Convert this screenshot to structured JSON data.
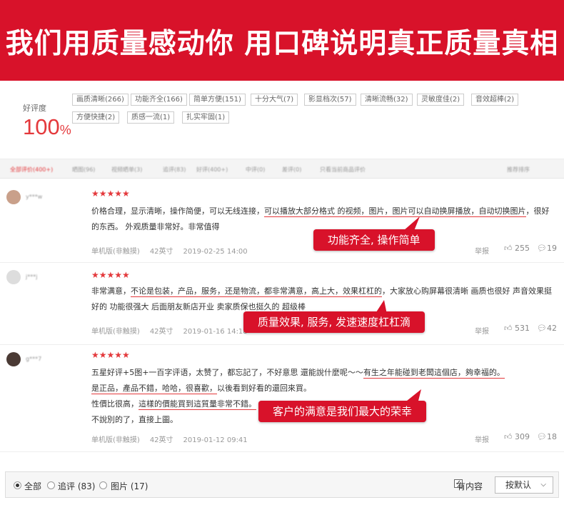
{
  "banner": {
    "title": "我们用质量感动你  用口碑说明真正质量真相"
  },
  "rating": {
    "label": "好评度",
    "value": "100",
    "unit": "%"
  },
  "tags": [
    "画质清晰(266)",
    "功能齐全(166)",
    "简单方便(151)",
    "十分大气(7)",
    "影显档次(57)",
    "清晰流畅(32)",
    "灵敏度佳(2)",
    "音效超棒(2)",
    "方便快捷(2)",
    "质感一流(1)",
    "扎实牢固(1)"
  ],
  "tabs": [
    "全部评价(400+)",
    "晒图(96)",
    "视频晒单(3)",
    "追评(83)",
    "好评(400+)",
    "中评(0)",
    "差评(0)",
    "只看当前商品评价",
    "推荐排序"
  ],
  "reviews": [
    {
      "user": "y***w",
      "stars": "★★★★★",
      "text": {
        "a": "价格合理，显示清晰，操作简便，可以无线连接，",
        "b": "可以播放大部分格式 的视频，图片，图片可以自动换屏播放，自动切换图片",
        "c": "，很好的东西。 外观质量非常好。非常值得"
      },
      "device": "单机版(非触摸)",
      "size": "42英寸",
      "date": "2019-02-25 14:00",
      "report": "举报",
      "likes": "255",
      "replies": "19",
      "callout": "功能齐全, 操作简单"
    },
    {
      "user": "j***j",
      "stars": "★★★★★",
      "text": {
        "a": "非常满意，",
        "b": "不论是包装，产品，服务，还是物流，都非常满意，高上大，效果杠杠的",
        "c": "，大家放心购屏幕很清晰 画质也很好 声音效果挺好的 功能很强大 后面朋友新店开业 卖家质保也挺久的 超级棒"
      },
      "device": "单机版(非触摸)",
      "size": "42英寸",
      "date": "2019-01-16 14:18",
      "report": "举报",
      "likes": "531",
      "replies": "42",
      "callout": "质量效果, 服务, 发速速度杠杠滴"
    },
    {
      "user": "g***7",
      "stars": "★★★★★",
      "text": {
        "l1a": "五星好评+5图+一百字评语，太赞了，都忘記了，不好意思  還能說什麼呢～～",
        "l1b": "有生之年能碰到老闆這個店，夠幸福的。",
        "l2": "是正品，產品不錯，哈哈，很喜歡，",
        "l2b": "以後看到好看的還回來買。",
        "l3a": "性價比很高，",
        "l3b": "這樣的價能買到這質量非常不錯。",
        "l4": "不說別的了，直接上圖。"
      },
      "device": "单机版(非触摸)",
      "size": "42英寸",
      "date": "2019-01-12 09:41",
      "report": "举报",
      "likes": "309",
      "replies": "18",
      "callout": "客户的满意是我们最大的荣幸"
    }
  ],
  "footer": {
    "filters": [
      "全部",
      "追评 (83)",
      "图片 (17)"
    ],
    "has_content": "有内容",
    "sort": "按默认"
  },
  "colors": {
    "brand_red": "#d8122a",
    "accent": "#e4393c"
  }
}
